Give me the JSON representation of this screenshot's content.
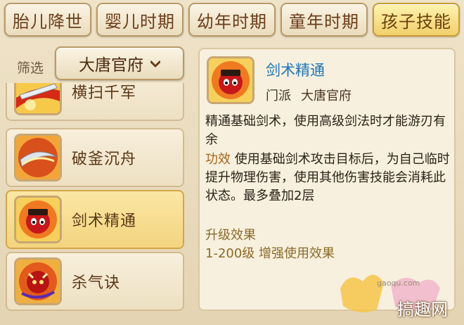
{
  "tabs": [
    {
      "label": "胎儿降世",
      "active": false
    },
    {
      "label": "婴儿时期",
      "active": false
    },
    {
      "label": "幼年时期",
      "active": false
    },
    {
      "label": "童年时期",
      "active": false
    },
    {
      "label": "孩子技能",
      "active": true
    }
  ],
  "filter": {
    "label": "筛选",
    "selected": "大唐官府"
  },
  "skills": [
    {
      "name": "横扫千军",
      "icon": "sword-slash-icon"
    },
    {
      "name": "破釜沉舟",
      "icon": "blade-wave-icon"
    },
    {
      "name": "剑术精通",
      "icon": "swordsman-face-icon",
      "active": true
    },
    {
      "name": "杀气诀",
      "icon": "red-demon-icon"
    }
  ],
  "detail": {
    "name": "剑术精通",
    "school_label": "门派",
    "school_value": "大唐官府",
    "description": "精通基础剑术，使用高级剑法时才能游刃有余",
    "effect_label": "功效",
    "effect_text": "使用基础剑术攻击目标后，为自己临时提升物理伤害，使用其他伤害技能会消耗此状态。最多叠加2层",
    "upgrade_title": "升级效果",
    "upgrade_text": "1-200级 增强使用效果"
  },
  "watermark": {
    "site": "gaoqu.com",
    "brand": "搞趣网"
  },
  "colors": {
    "accent_tab": "#f0d06a",
    "skill_name_blue": "#1d75b8",
    "effect_label": "#a0651c"
  }
}
